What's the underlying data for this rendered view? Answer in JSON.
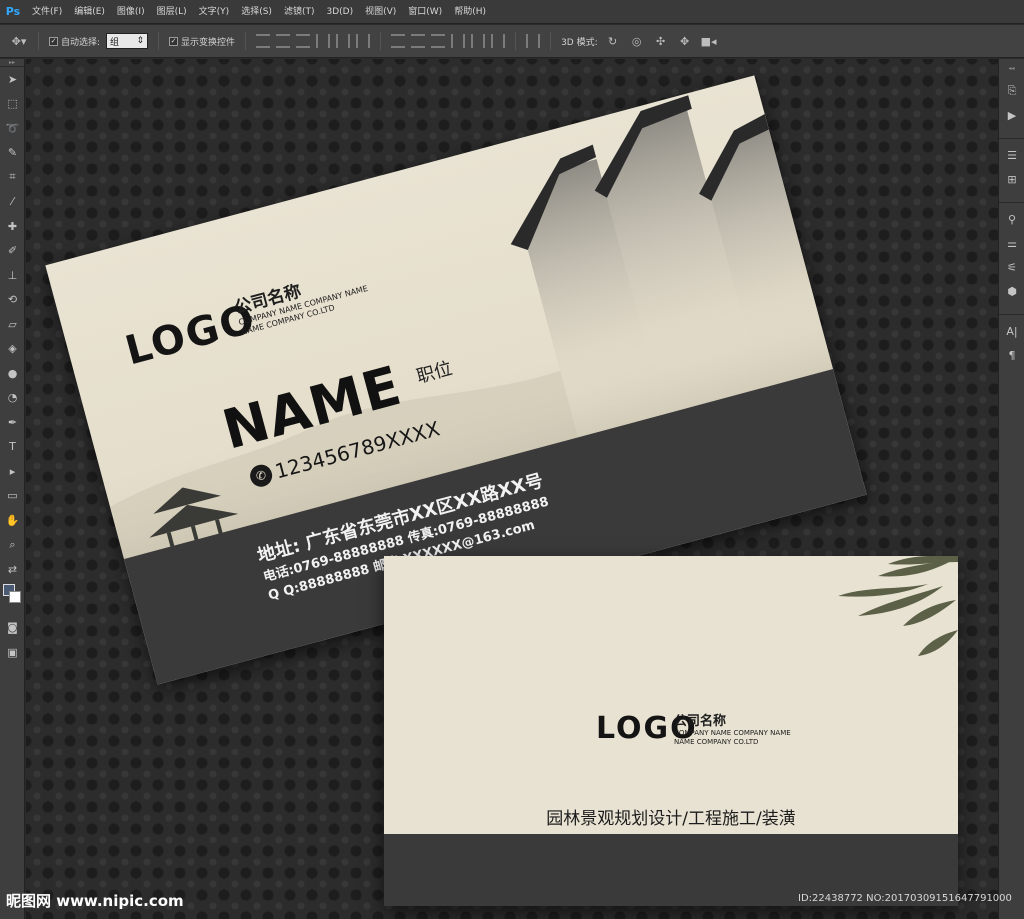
{
  "app": {
    "logo": "Ps",
    "menu": [
      "文件(F)",
      "编辑(E)",
      "图像(I)",
      "图层(L)",
      "文字(Y)",
      "选择(S)",
      "滤镜(T)",
      "3D(D)",
      "视图(V)",
      "窗口(W)",
      "帮助(H)"
    ]
  },
  "options": {
    "auto_select_label": "自动选择:",
    "auto_select_value": "组",
    "show_transform_label": "显示变换控件",
    "mode_3d_label": "3D 模式:"
  },
  "colors": {
    "foreground": "#4a5a73",
    "background": "#ffffff"
  },
  "front_card": {
    "logo": "LOGO",
    "company_cn": "公司名称",
    "company_en_1": "COMPANY NAME COMPANY NAME",
    "company_en_2": "NAME COMPANY CO.LTD",
    "name": "NAME",
    "title": "职位",
    "phone": "123456789XXXX",
    "address": "地址:  广东省东莞市XX区XX路XX号",
    "tel_fax": "电话:0769-88888888  传真:0769-88888888",
    "qq_email": "Q Q:88888888  邮箱:XXXXXX@163.com"
  },
  "back_card": {
    "logo": "LOGO",
    "company_cn": "公司名称",
    "company_en_1": "COMPANY NAME COMPANY NAME",
    "company_en_2": "NAME COMPANY CO.LTD",
    "services": "园林景观规划设计/工程施工/装潢"
  },
  "watermark": "昵图网 www.nipic.com",
  "image_id": "ID:22438772 NO:20170309151647791000"
}
